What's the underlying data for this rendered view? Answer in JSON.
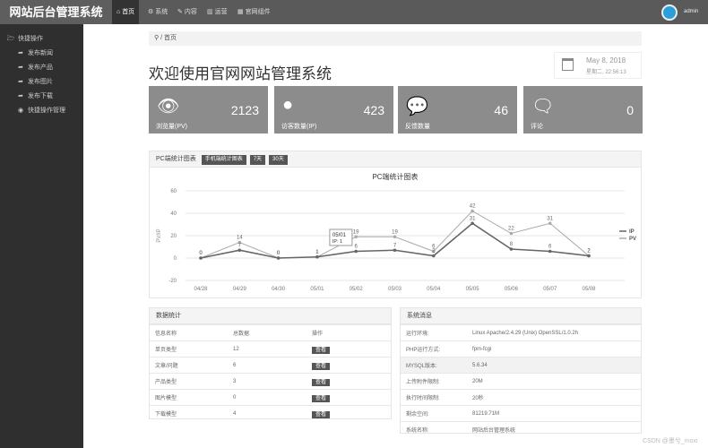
{
  "header": {
    "logo": "网站后台管理系统",
    "nav": [
      {
        "icon": "home-icon",
        "label": "首页"
      },
      {
        "icon": "cogs-icon",
        "label": "系统"
      },
      {
        "icon": "edit-icon",
        "label": "内容"
      },
      {
        "icon": "bar-chart-icon",
        "label": "运营"
      },
      {
        "icon": "columns-icon",
        "label": "官网组件"
      }
    ],
    "user": "admin"
  },
  "sidebar": {
    "group": "快捷操作",
    "items": [
      {
        "icon": "share-icon",
        "label": "发布新闻"
      },
      {
        "icon": "share-icon",
        "label": "发布产品"
      },
      {
        "icon": "share-icon",
        "label": "发布图片"
      },
      {
        "icon": "share-icon",
        "label": "发布下载"
      },
      {
        "icon": "eye-icon",
        "label": "快捷操作管理"
      }
    ]
  },
  "breadcrumb": {
    "sep": "/",
    "current": "首页"
  },
  "page_title": "欢迎使用官网网站管理系统",
  "date": {
    "date": "May 8, 2018",
    "time": "星期二, 22:56:13"
  },
  "stats": [
    {
      "icon": "eye-icon",
      "value": "2123",
      "label": "浏览量(PV)"
    },
    {
      "icon": "user-icon",
      "value": "423",
      "label": "访客数量(IP)"
    },
    {
      "icon": "comments-icon",
      "value": "46",
      "label": "反馈数量"
    },
    {
      "icon": "comment-icon",
      "value": "0",
      "label": "评论"
    }
  ],
  "chart_panel": {
    "title": "PC端统计图表",
    "buttons": [
      "手机端统计图表",
      "7天",
      "30天"
    ]
  },
  "chart_data": {
    "type": "line",
    "title": "PC端统计图表",
    "ylabel": "PV/IP",
    "ylim": [
      -20,
      60
    ],
    "yticks": [
      60,
      40,
      20,
      0,
      -20
    ],
    "categories": [
      "04/28",
      "04/29",
      "04/30",
      "05/01",
      "05/02",
      "05/03",
      "05/04",
      "05/05",
      "05/06",
      "05/07",
      "05/08"
    ],
    "series": [
      {
        "name": "IP",
        "values": [
          0,
          7,
          0,
          1,
          6,
          7,
          2,
          31,
          8,
          6,
          2
        ],
        "color": "#666666"
      },
      {
        "name": "PV",
        "values": [
          0,
          14,
          0,
          1,
          19,
          19,
          6,
          42,
          22,
          31,
          2
        ],
        "color": "#aaaaaa"
      }
    ],
    "legend": "right",
    "tooltip": {
      "date": "05/01",
      "text": "IP: 1"
    }
  },
  "data_stats": {
    "title": "数据统计",
    "headers": [
      "信息名称",
      "总数据",
      "操作"
    ],
    "rows": [
      [
        "单页类型",
        "12",
        "查看"
      ],
      [
        "文章/问题",
        "6",
        "查看"
      ],
      [
        "产品类型",
        "3",
        "查看"
      ],
      [
        "图片模型",
        "0",
        "查看"
      ],
      [
        "下载模型",
        "4",
        "查看"
      ]
    ]
  },
  "sys_info": {
    "title": "系统消息",
    "rows": [
      [
        "运行环境:",
        "Linux Apache/2.4.29 (Unix) OpenSSL/1.0.2h"
      ],
      [
        "PHP运行方式:",
        "fpm-fcgi"
      ],
      [
        "MYSQL版本:",
        "5.6.34"
      ],
      [
        "上传附件限制:",
        "20M"
      ],
      [
        "执行时间限制:",
        "20秒"
      ],
      [
        "剩余空间:",
        "81219.71M"
      ],
      [
        "系统名称:",
        "网站后台管理系统"
      ]
    ]
  },
  "watermark": "CSDN @墨兮_moxi"
}
